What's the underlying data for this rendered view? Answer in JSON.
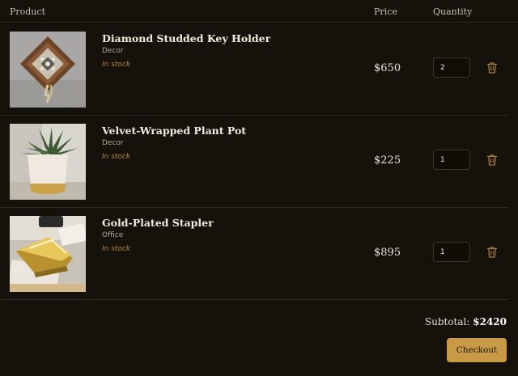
{
  "header": {
    "product_label": "Product",
    "price_label": "Price",
    "quantity_label": "Quantity"
  },
  "items": [
    {
      "name": "Diamond Studded Key Holder",
      "category": "Decor",
      "stock": "In stock",
      "price": "$650",
      "quantity": "2",
      "image_icon": "key-holder-photo"
    },
    {
      "name": "Velvet-Wrapped Plant Pot",
      "category": "Decor",
      "stock": "In stock",
      "price": "$225",
      "quantity": "1",
      "image_icon": "plant-pot-photo"
    },
    {
      "name": "Gold-Plated Stapler",
      "category": "Office",
      "stock": "In stock",
      "price": "$895",
      "quantity": "1",
      "image_icon": "stapler-photo"
    }
  ],
  "summary": {
    "subtotal_label": "Subtotal:",
    "subtotal_value": "$2420",
    "checkout_label": "Checkout"
  },
  "colors": {
    "background": "#15120b",
    "accent": "#c89a45",
    "stock_text": "#b88a3c",
    "trash_icon": "#a57a3a"
  }
}
